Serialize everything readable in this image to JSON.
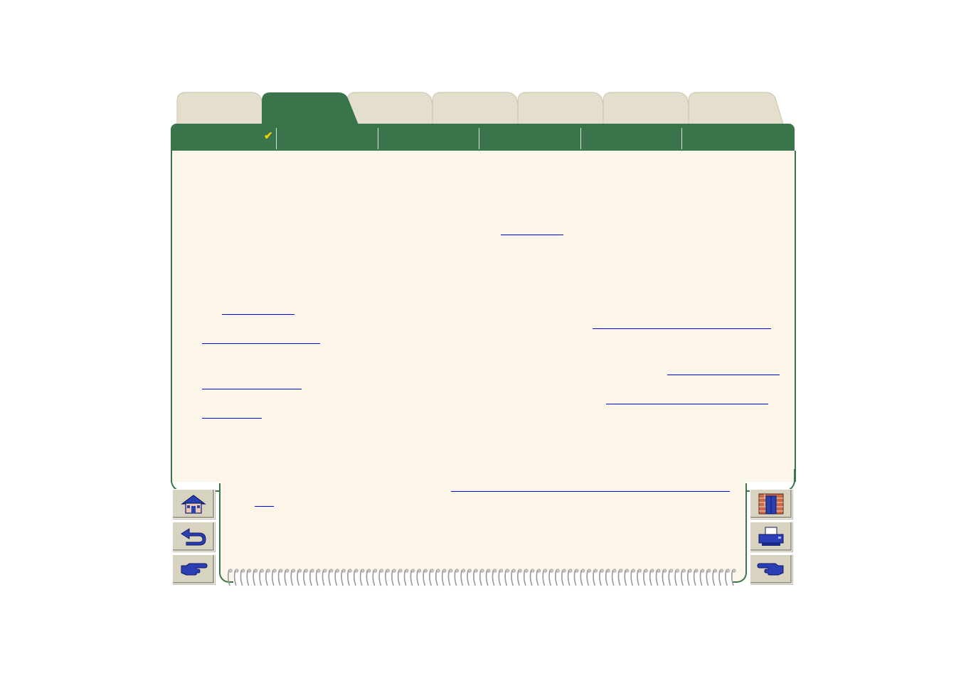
{
  "tabs": [
    {
      "label": ""
    },
    {
      "label": "",
      "active": true
    },
    {
      "label": ""
    },
    {
      "label": ""
    },
    {
      "label": ""
    },
    {
      "label": ""
    },
    {
      "label": ""
    }
  ],
  "section_bar": {
    "check_mark": "✔",
    "segments": [
      "",
      "",
      "",
      "",
      "",
      ""
    ]
  },
  "content": {
    "links": [
      "",
      "",
      "",
      "",
      "",
      "",
      "",
      "",
      "",
      ""
    ]
  },
  "nav_left": [
    {
      "icon": "home-icon"
    },
    {
      "icon": "back-arrow-icon"
    },
    {
      "icon": "next-hand-icon"
    }
  ],
  "nav_right": [
    {
      "icon": "exit-door-icon"
    },
    {
      "icon": "printer-icon"
    },
    {
      "icon": "previous-hand-icon"
    }
  ],
  "colors": {
    "green": "#3a744a",
    "page": "#fcf6ea",
    "tab_inactive": "#e4dfcc",
    "link": "#0000ee"
  }
}
